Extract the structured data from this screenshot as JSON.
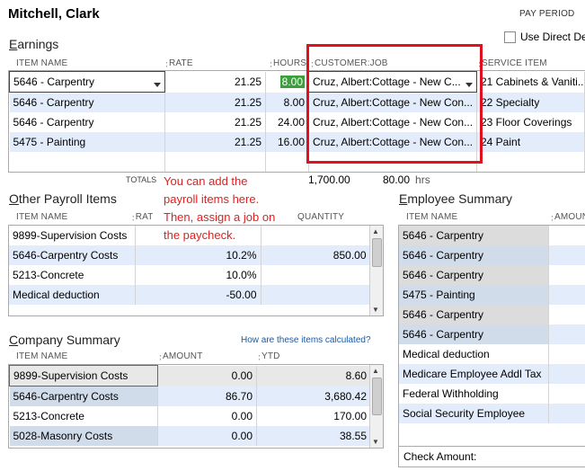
{
  "employee": {
    "name": "Mitchell, Clark"
  },
  "header": {
    "pay_period_label": "PAY PERIOD",
    "use_direct_label": "Use Direct De"
  },
  "earnings": {
    "title": "Earnings",
    "columns": [
      "ITEM NAME",
      "RATE",
      "HOURS",
      "CUSTOMER:JOB",
      "SERVICE ITEM"
    ],
    "rows": [
      {
        "item": "5646 - Carpentry",
        "rate": "21.25",
        "hours": "8.00",
        "job": "Cruz, Albert:Cottage - New C...",
        "service": "21 Cabinets & Vaniti..."
      },
      {
        "item": "5646 - Carpentry",
        "rate": "21.25",
        "hours": "8.00",
        "job": "Cruz, Albert:Cottage - New Con...",
        "service": "22 Specialty"
      },
      {
        "item": "5646 - Carpentry",
        "rate": "21.25",
        "hours": "24.00",
        "job": "Cruz, Albert:Cottage - New Con...",
        "service": "23 Floor Coverings"
      },
      {
        "item": "5475 - Painting",
        "rate": "21.25",
        "hours": "16.00",
        "job": "Cruz, Albert:Cottage - New Con...",
        "service": "24 Paint"
      }
    ],
    "totals_label": "TOTALS",
    "total_amount": "1,700.00",
    "total_hours": "80.00",
    "hours_unit": "hrs"
  },
  "annotation": {
    "lines": [
      "You can add the",
      "payroll items here.",
      "Then, assign a job on",
      "the paycheck."
    ]
  },
  "other_payroll": {
    "title": "Other Payroll Items",
    "columns": [
      "ITEM NAME",
      "RATE",
      "QUANTITY"
    ],
    "rows": [
      {
        "item": "9899-Supervision Costs",
        "rate": "",
        "qty": ""
      },
      {
        "item": "5646-Carpentry Costs",
        "rate": "10.2%",
        "qty": "850.00"
      },
      {
        "item": "5213-Concrete",
        "rate": "10.0%",
        "qty": ""
      },
      {
        "item": "Medical deduction",
        "rate": "-50.00",
        "qty": ""
      }
    ]
  },
  "company_summary": {
    "title": "Company Summary",
    "link": "How are these items calculated?",
    "columns": [
      "ITEM NAME",
      "AMOUNT",
      "YTD"
    ],
    "rows": [
      {
        "item": "9899-Supervision Costs",
        "amount": "0.00",
        "ytd": "8.60"
      },
      {
        "item": "5646-Carpentry Costs",
        "amount": "86.70",
        "ytd": "3,680.42"
      },
      {
        "item": "5213-Concrete",
        "amount": "0.00",
        "ytd": "170.00"
      },
      {
        "item": "5028-Masonry Costs",
        "amount": "0.00",
        "ytd": "38.55"
      }
    ]
  },
  "employee_summary": {
    "title": "Employee Summary",
    "columns": [
      "ITEM NAME",
      "AMOUN"
    ],
    "rows": [
      {
        "item": "5646 - Carpentry"
      },
      {
        "item": "5646 - Carpentry"
      },
      {
        "item": "5646 - Carpentry"
      },
      {
        "item": "5475 - Painting"
      },
      {
        "item": "5646 - Carpentry"
      },
      {
        "item": "5646 - Carpentry"
      },
      {
        "item": "Medical deduction"
      },
      {
        "item": "Medicare Employee Addl Tax"
      },
      {
        "item": "Federal Withholding"
      },
      {
        "item": "Social Security Employee"
      }
    ],
    "check_amount_label": "Check Amount:"
  }
}
